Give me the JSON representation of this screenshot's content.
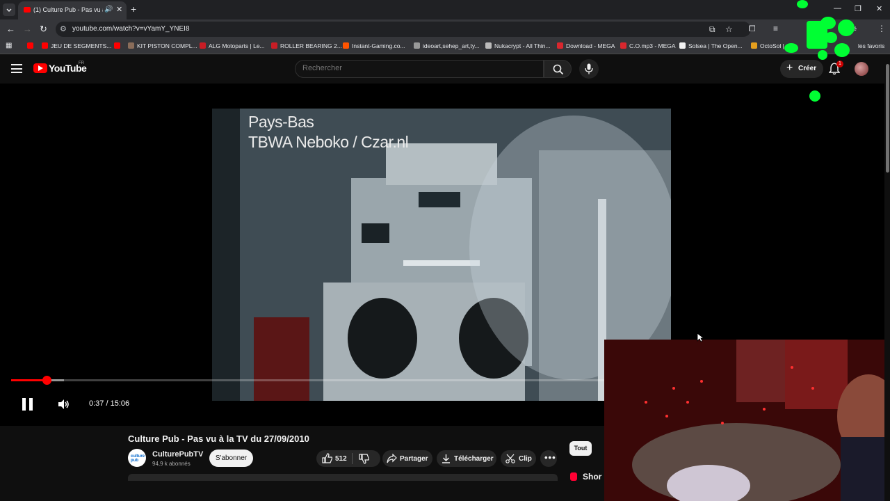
{
  "browser": {
    "tab_title": "(1) Culture Pub - Pas vu à la",
    "url": "youtube.com/watch?v=vYamY_YNEI8",
    "bookmarks": [
      {
        "label": "JEU DE SEGMENTS...",
        "color": "#ff0000"
      },
      {
        "label": "KIT PISTON COMPL...",
        "color": "#8a6d5a"
      },
      {
        "label": "ALG Motoparts | Le...",
        "color": "#c81d25"
      },
      {
        "label": "ROLLER BEARING 2...",
        "color": "#c81d25"
      },
      {
        "label": "Instant-Gaming.co...",
        "color": "#ff5400"
      },
      {
        "label": "ideoart,sehep_art,ty...",
        "color": "#999999"
      },
      {
        "label": "Nukacrypt - All Thin...",
        "color": "#bbbbbb"
      },
      {
        "label": "Download - MEGA",
        "color": "#d9272e"
      },
      {
        "label": "C.O.mp3 - MEGA",
        "color": "#d9272e"
      },
      {
        "label": "Solsea | The Open...",
        "color": "#f2f2f2"
      },
      {
        "label": "OctoSol |",
        "color": "#e6a01e"
      }
    ],
    "bookmarks_more": "les favoris",
    "profile_partial": "bité"
  },
  "youtube": {
    "logo_text": "YouTube",
    "country_code": "FR",
    "search_placeholder": "Rechercher",
    "create_label": "Créer",
    "notification_count": "1"
  },
  "player": {
    "caption_line1": "Pays-Bas",
    "caption_line2": "TBWA Neboko / Czar.nl",
    "time_display": "0:37 / 15:06",
    "progress_played": 0.041,
    "progress_buffered": 0.061
  },
  "video": {
    "title": "Culture Pub - Pas vu à la TV du 27/09/2010",
    "channel_name": "CulturePubTV",
    "channel_avatar_text": "culture pub",
    "subscribers": "94,9 k abonnés",
    "subscribe_label": "S'abonner",
    "likes": "512",
    "share_label": "Partager",
    "download_label": "Télécharger",
    "clip_label": "Clip"
  },
  "sidebar": {
    "chip_all": "Tout",
    "shorts_label": "Shor"
  },
  "colors": {
    "accent": "#ff0000",
    "overlay_green": "#00ff33"
  }
}
